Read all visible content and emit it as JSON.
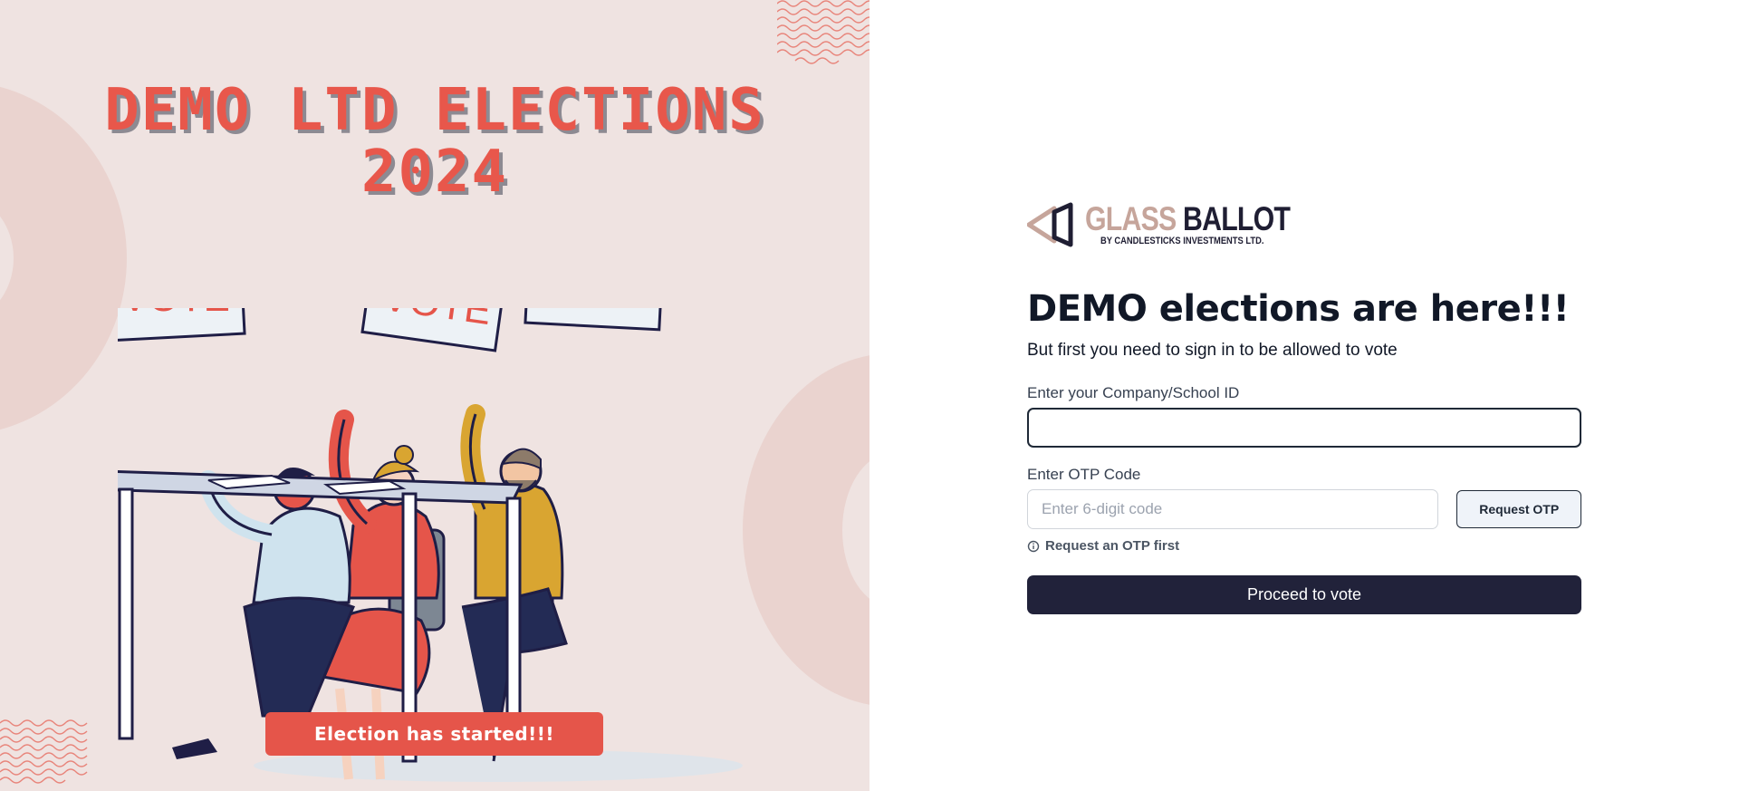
{
  "event": {
    "title_line1": "DEMO LTD ELECTIONS",
    "title_line2": "2024",
    "status_banner": "Election has started!!!",
    "sign_text": "VOTE"
  },
  "brand": {
    "name_part1": "GLASS",
    "name_part2": "BALLOT",
    "tagline": "BY CANDLESTICKS INVESTMENTS LTD."
  },
  "signin": {
    "headline": "DEMO elections are here!!!",
    "subtext": "But first you need to sign in to be allowed to vote",
    "id_label": "Enter your Company/School ID",
    "id_value": "",
    "otp_label": "Enter OTP Code",
    "otp_placeholder": "Enter 6-digit code",
    "request_otp_button": "Request OTP",
    "hint": "Request an OTP first",
    "proceed_button": "Proceed to vote"
  },
  "colors": {
    "accent_red": "#e8574b",
    "primary_dark": "#21223a",
    "left_background": "#efe3e1",
    "brand_tan": "#c6a59b"
  },
  "icons": {
    "hint_icon": "info-circle-icon",
    "logo_icon": "glass-ballot-logo-icon"
  }
}
